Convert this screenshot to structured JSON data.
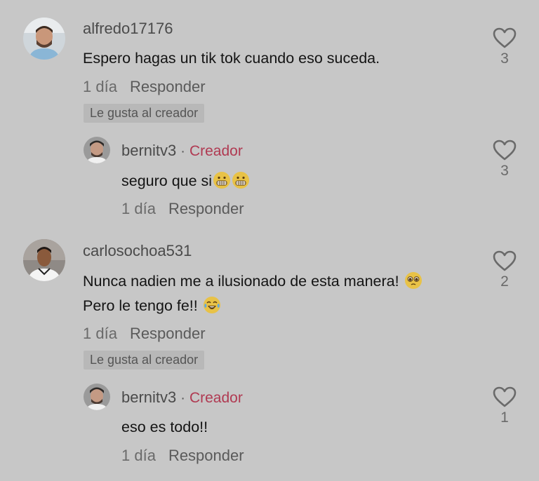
{
  "comments": [
    {
      "username": "alfredo17176",
      "text": "Espero hagas un tik tok cuando eso suceda.",
      "time": "1 día",
      "reply_label": "Responder",
      "badge": "Le gusta al creador",
      "likes": "3",
      "avatar_icon": "user-avatar-icon"
    },
    {
      "username": "bernitv3",
      "separator": "·",
      "creator_tag": "Creador",
      "text": "seguro que si",
      "emojis": [
        "grimacing-face-emoji",
        "grimacing-face-emoji"
      ],
      "time": "1 día",
      "reply_label": "Responder",
      "likes": "3",
      "avatar_icon": "creator-avatar-icon"
    },
    {
      "username": "carlosochoa531",
      "text_line1": "Nunca nadien me a ilusionado de esta manera!",
      "text_line2": "Pero le tengo fe!!",
      "emojis": [
        "pleading-face-emoji",
        "tears-of-joy-emoji"
      ],
      "time": "1 día",
      "reply_label": "Responder",
      "badge": "Le gusta al creador",
      "likes": "2",
      "avatar_icon": "user-avatar-icon"
    },
    {
      "username": "bernitv3",
      "separator": "·",
      "creator_tag": "Creador",
      "text": "eso es todo!!",
      "time": "1 día",
      "reply_label": "Responder",
      "likes": "1",
      "avatar_icon": "creator-avatar-icon"
    }
  ],
  "colors": {
    "background": "#c7c7c7",
    "creator_tag": "#b03a52",
    "badge_bg": "#b8b8b8",
    "text": "#141414"
  }
}
